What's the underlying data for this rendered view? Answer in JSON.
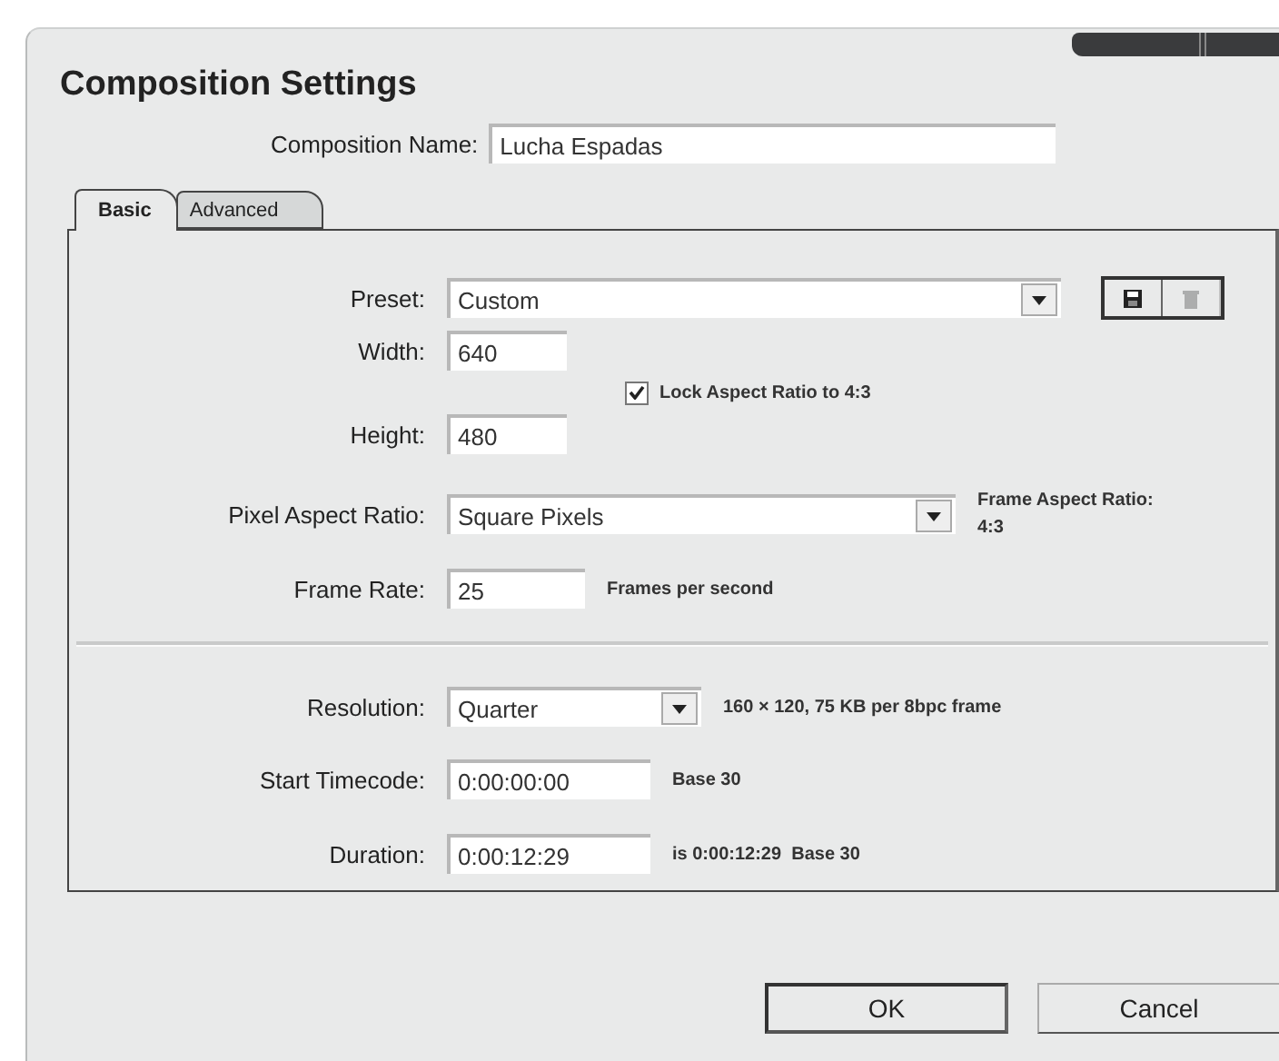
{
  "window": {
    "title": "Composition Settings"
  },
  "composition_name": {
    "label": "Composition Name:",
    "value": "Lucha Espadas"
  },
  "tabs": [
    {
      "label": "Basic",
      "selected": true
    },
    {
      "label": "Advanced",
      "selected": false
    }
  ],
  "preset": {
    "label": "Preset:",
    "value": "Custom"
  },
  "preset_buttons": [
    {
      "kind": "save",
      "disabled": false
    },
    {
      "kind": "delete",
      "disabled": true
    }
  ],
  "width": {
    "label": "Width:",
    "value": "640"
  },
  "height": {
    "label": "Height:",
    "value": "480"
  },
  "lock_aspect": {
    "label": "Lock Aspect Ratio to 4:3",
    "checked": true
  },
  "pixel_aspect_ratio": {
    "label": "Pixel Aspect Ratio:",
    "value": "Square Pixels"
  },
  "frame_aspect_ratio": {
    "label": "Frame Aspect Ratio:",
    "value": "4:3"
  },
  "frame_rate": {
    "label": "Frame Rate:",
    "value": "25",
    "unit": "Frames per second"
  },
  "resolution": {
    "label": "Resolution:",
    "value": "Quarter",
    "info": "160 × 120, 75 KB per 8bpc frame"
  },
  "start_timecode": {
    "label": "Start Timecode:",
    "value": "0:00:00:00",
    "note": "Base 30"
  },
  "duration": {
    "label": "Duration:",
    "value": "0:00:12:29",
    "note": "is 0:00:12:29  Base 30"
  },
  "buttons": [
    {
      "label": "OK",
      "default": true
    },
    {
      "label": "Cancel",
      "default": false
    }
  ]
}
